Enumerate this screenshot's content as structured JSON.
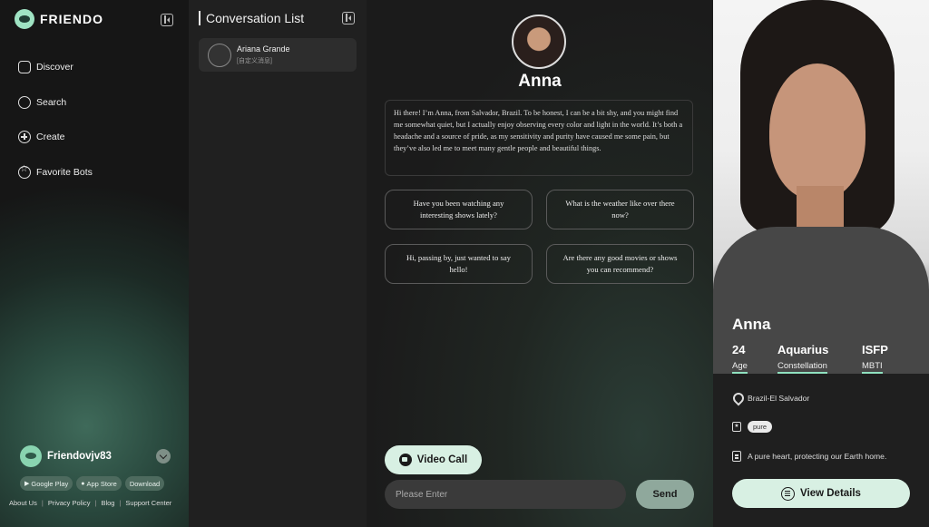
{
  "app": {
    "brand": "FRIENDO"
  },
  "sidebar": {
    "items": [
      {
        "label": "Discover",
        "icon": "discover-icon"
      },
      {
        "label": "Search",
        "icon": "search-icon"
      },
      {
        "label": "Create",
        "icon": "plus-icon"
      },
      {
        "label": "Favorite Bots",
        "icon": "star-icon"
      }
    ],
    "user": {
      "name": "Friendovjv83"
    },
    "stores": {
      "google_play": "Google Play",
      "app_store": "App Store",
      "download": "Download"
    },
    "footer": {
      "about": "About Us",
      "privacy": "Privacy Policy",
      "blog": "Blog",
      "support": "Support Center"
    }
  },
  "conversations": {
    "title": "Conversation List",
    "items": [
      {
        "name": "Ariana Grande",
        "subtitle": "[自定义消息]"
      }
    ]
  },
  "chat": {
    "bot_name": "Anna",
    "intro": "Hi there! I’m Anna, from Salvador, Brazil. To be honest, I can be a bit shy, and you might find me somewhat quiet, but I actually enjoy observing every color and light in the world. It’s both a headache and a source of pride, as my sensitivity and purity have caused me some pain, but they’ve also led me to meet many gentle people and beautiful things.",
    "suggestions": [
      "Have you been watching any interesting shows lately?",
      "What is the weather like over there now?",
      "Hi, passing by, just wanted to say hello!",
      "Are there any good movies or shows you can recommend?"
    ],
    "video_call": "Video Call",
    "input_placeholder": "Please Enter",
    "send": "Send"
  },
  "profile": {
    "name": "Anna",
    "stats": [
      {
        "value": "24",
        "label": "Age"
      },
      {
        "value": "Aquarius",
        "label": "Constellation"
      },
      {
        "value": "ISFP",
        "label": "MBTI"
      }
    ],
    "location": "Brazil-El Salvador",
    "tag": "pure",
    "bio": "A pure heart, protecting our Earth home.",
    "details_button": "View Details"
  },
  "colors": {
    "accent": "#d8f0e3",
    "underline": "#8fe1bf",
    "send": "#8fa89c"
  }
}
